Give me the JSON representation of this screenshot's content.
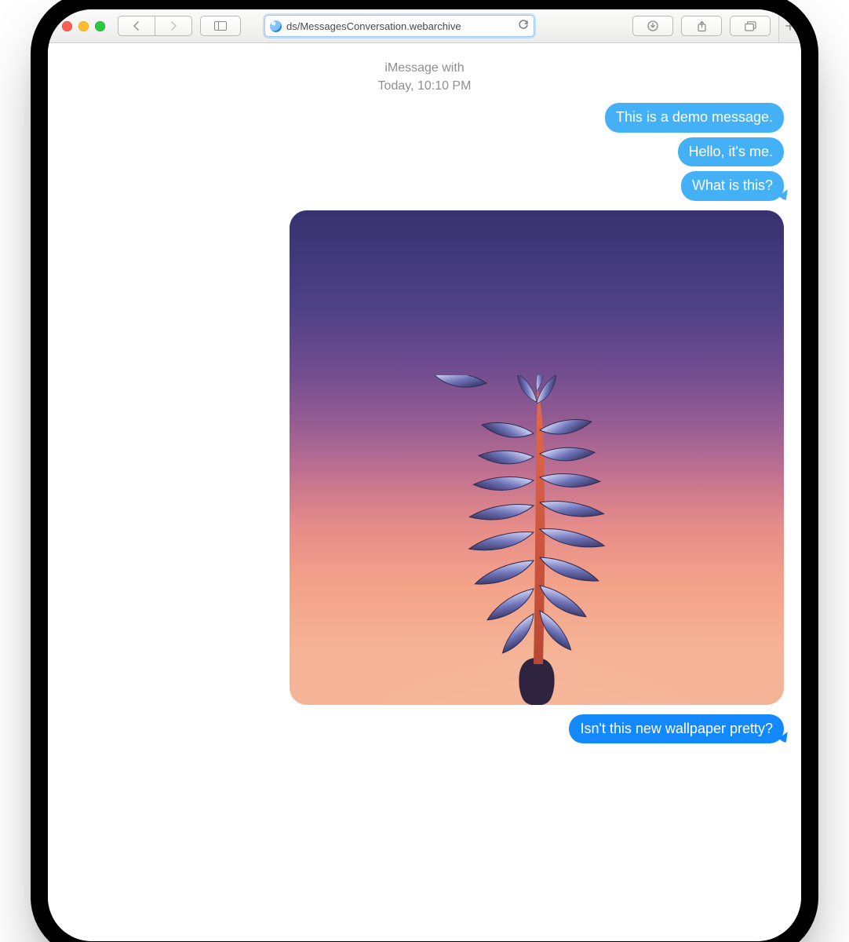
{
  "toolbar": {
    "address_text": "ds/MessagesConversation.webarchive",
    "icons": {
      "back": "back-icon",
      "forward": "forward-icon",
      "sidebar": "sidebar-icon",
      "reload": "reload-icon",
      "download": "download-icon",
      "share": "share-icon",
      "tabs": "tabs-overview-icon",
      "newtab": "new-tab-icon",
      "globe": "globe-icon"
    }
  },
  "header": {
    "line1": "iMessage with",
    "line2": "Today, 10:10 PM"
  },
  "messages": {
    "received": [
      "This is a demo message.",
      "Hello, it's me.",
      "What is this?"
    ],
    "outgoing": [
      "Isn't this new wallpaper pretty?"
    ],
    "attachment": {
      "alt": "wallpaper-plant-image"
    }
  },
  "colors": {
    "received_bubble": "#44b1f6",
    "outgoing_bubble": "#1489fe"
  }
}
